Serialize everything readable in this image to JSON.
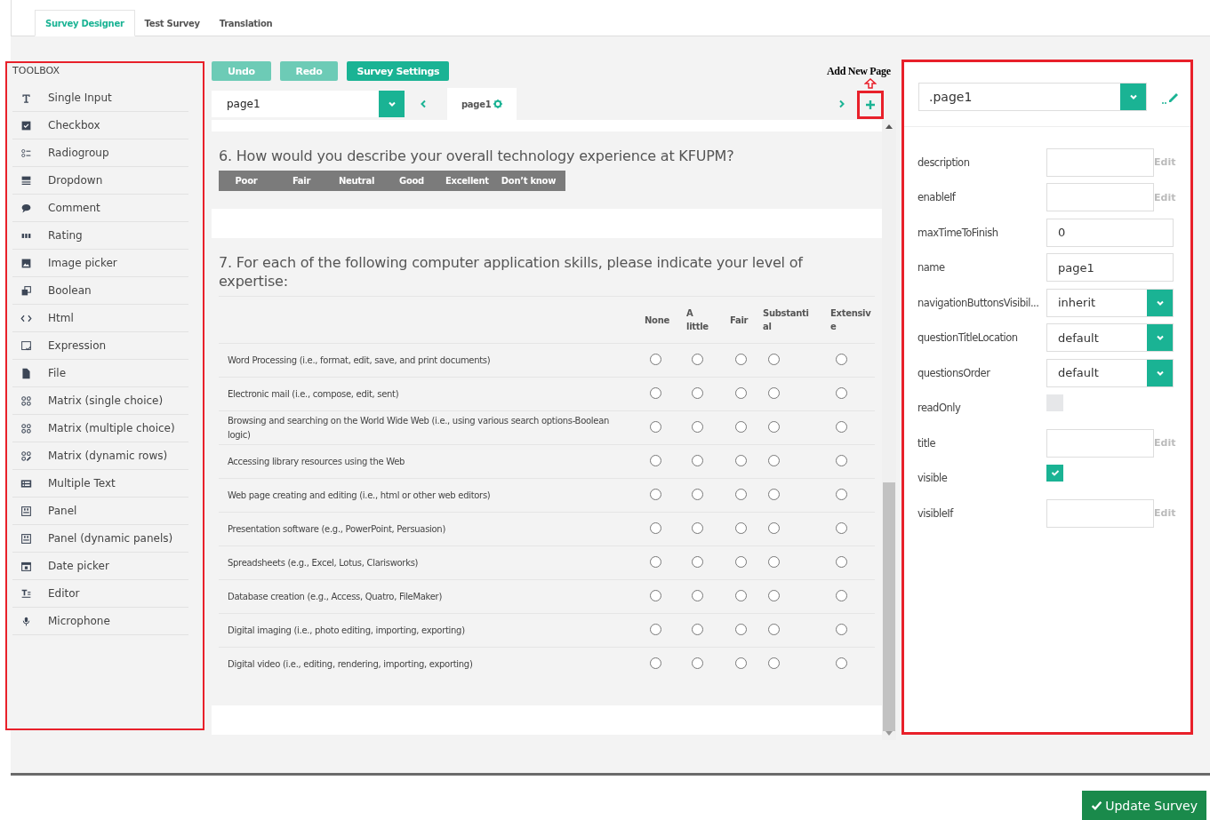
{
  "tabs": [
    {
      "label": "Survey Designer",
      "selected": true
    },
    {
      "label": "Test Survey",
      "selected": false
    },
    {
      "label": "Translation",
      "selected": false
    }
  ],
  "toolbox": {
    "title": "TOOLBOX",
    "items": [
      "Single Input",
      "Checkbox",
      "Radiogroup",
      "Dropdown",
      "Comment",
      "Rating",
      "Image picker",
      "Boolean",
      "Html",
      "Expression",
      "File",
      "Matrix (single choice)",
      "Matrix (multiple choice)",
      "Matrix (dynamic rows)",
      "Multiple Text",
      "Panel",
      "Panel (dynamic panels)",
      "Date picker",
      "Editor",
      "Microphone"
    ]
  },
  "actions": [
    {
      "label": "Undo",
      "disabled": true
    },
    {
      "label": "Redo",
      "disabled": true
    },
    {
      "label": "Survey Settings",
      "disabled": false
    }
  ],
  "page_select": {
    "value": "page1"
  },
  "page_tab": {
    "label": "page1"
  },
  "annotation": {
    "label": "Add New Page"
  },
  "questions": [
    {
      "kind": "rating",
      "title": "6. How would you describe your overall technology experience at KFUPM?",
      "options": [
        "Poor",
        "Fair",
        "Neutral",
        "Good",
        "Excellent",
        "Don’t know"
      ]
    },
    {
      "kind": "matrix",
      "title": "7. For each of the following computer application skills, please indicate your level of expertise:",
      "columns": [
        "None",
        "A little",
        "Fair",
        "Substantial",
        "Extensive"
      ],
      "rows": [
        {
          "label": "Word Processing (i.e., format, edit, save, and print documents)",
          "selected": [
            false,
            false,
            false,
            false,
            false
          ]
        },
        {
          "label": "Electronic mail (i.e., compose, edit, sent)",
          "selected": [
            false,
            false,
            false,
            false,
            false
          ]
        },
        {
          "label": "Browsing and searching on the World Wide Web (i.e., using various search options-Boolean logic)",
          "selected": [
            false,
            false,
            false,
            false,
            false
          ]
        },
        {
          "label": "Accessing library resources using the Web",
          "selected": [
            false,
            false,
            false,
            false,
            false
          ]
        },
        {
          "label": "Web page creating and editing (i.e., html or other web editors)",
          "selected": [
            false,
            false,
            false,
            false,
            false
          ]
        },
        {
          "label": "Presentation software (e.g., PowerPoint, Persuasion)",
          "selected": [
            false,
            false,
            false,
            false,
            false
          ]
        },
        {
          "label": "Spreadsheets (e.g., Excel, Lotus, Clarisworks)",
          "selected": [
            false,
            false,
            false,
            false,
            false
          ]
        },
        {
          "label": "Database creation (e.g., Access, Quatro, FileMaker)",
          "selected": [
            false,
            false,
            false,
            false,
            false
          ]
        },
        {
          "label": "Digital imaging (i.e., photo editing, importing, exporting)",
          "selected": [
            false,
            false,
            false,
            false,
            false
          ]
        },
        {
          "label": "Digital video (i.e., editing, rendering, importing, exporting)",
          "selected": [
            false,
            false,
            false,
            false,
            false
          ]
        }
      ]
    }
  ],
  "properties": {
    "object": ".page1",
    "items": [
      {
        "label": "description",
        "kind": "edit",
        "value": "",
        "action": "Edit"
      },
      {
        "label": "enableIf",
        "kind": "edit",
        "value": "",
        "action": "Edit"
      },
      {
        "label": "maxTimeToFinish",
        "kind": "text",
        "value": "0"
      },
      {
        "label": "name",
        "kind": "text",
        "value": "page1"
      },
      {
        "label": "navigationButtonsVisibil...",
        "kind": "select",
        "value": "inherit"
      },
      {
        "label": "questionTitleLocation",
        "kind": "select",
        "value": "default"
      },
      {
        "label": "questionsOrder",
        "kind": "select",
        "value": "default"
      },
      {
        "label": "readOnly",
        "kind": "checkbox",
        "checked": false
      },
      {
        "label": "title",
        "kind": "edit",
        "value": "",
        "action": "Edit"
      },
      {
        "label": "visible",
        "kind": "checkbox",
        "checked": true
      },
      {
        "label": "visibleIf",
        "kind": "edit",
        "value": "",
        "action": "Edit"
      }
    ]
  },
  "update_button": {
    "label": "Update Survey"
  }
}
